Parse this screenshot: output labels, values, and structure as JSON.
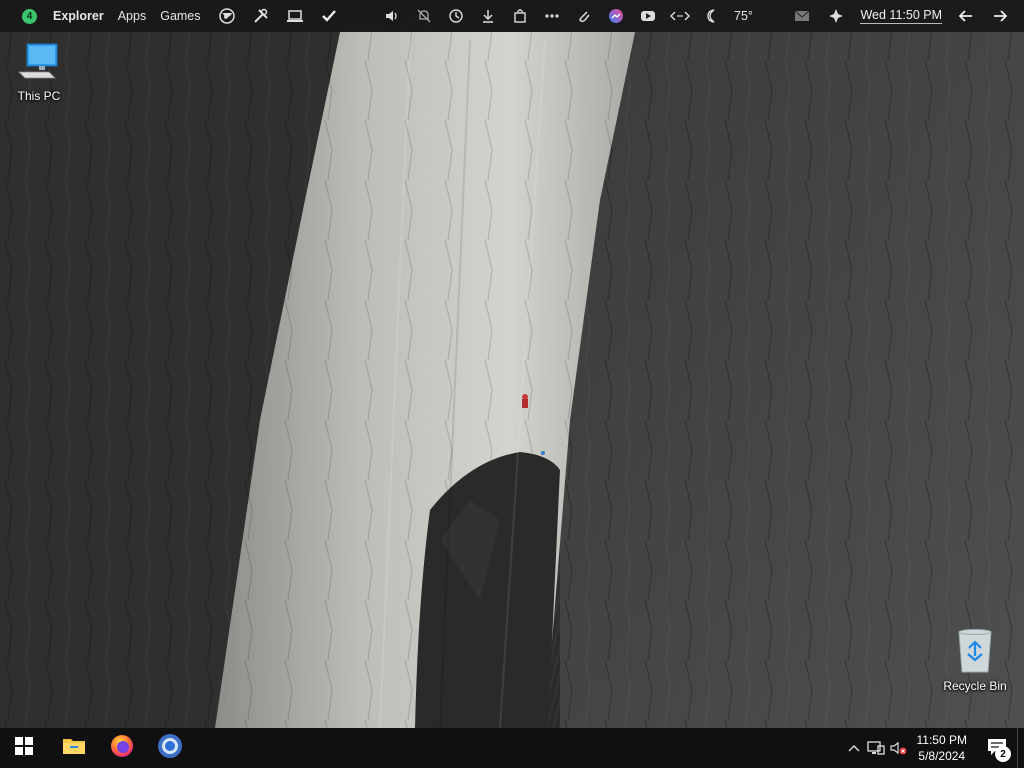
{
  "topbar": {
    "workspace_number": "4",
    "links": [
      "Explorer",
      "Apps",
      "Games"
    ],
    "weather_temp": "75°",
    "clock": "Wed 11:50 PM",
    "left_icons": [
      "globe-icon",
      "tools-icon",
      "laptop-icon",
      "checkmark-icon"
    ],
    "center_icons": [
      "volume-icon",
      "mute-bell-icon",
      "history-icon",
      "download-icon",
      "shopping-bag-icon",
      "ellipsis-icon",
      "paperclip-icon",
      "messenger-icon",
      "youtube-icon",
      "code-arrows-icon",
      "moon-icon"
    ],
    "right_icons": [
      "mail-icon",
      "sparkle-icon",
      "arrow-left-icon",
      "arrow-right-icon"
    ]
  },
  "desktop": {
    "icons": [
      {
        "label": "This PC",
        "icon": "this-pc-icon"
      },
      {
        "label": "Recycle Bin",
        "icon": "recycle-bin-icon"
      }
    ]
  },
  "taskbar": {
    "apps": [
      "windows-start-icon",
      "file-explorer-icon",
      "firefox-icon",
      "chrome-icon"
    ],
    "tray_time": "11:50 PM",
    "tray_date": "5/8/2024",
    "notification_count": "2"
  }
}
